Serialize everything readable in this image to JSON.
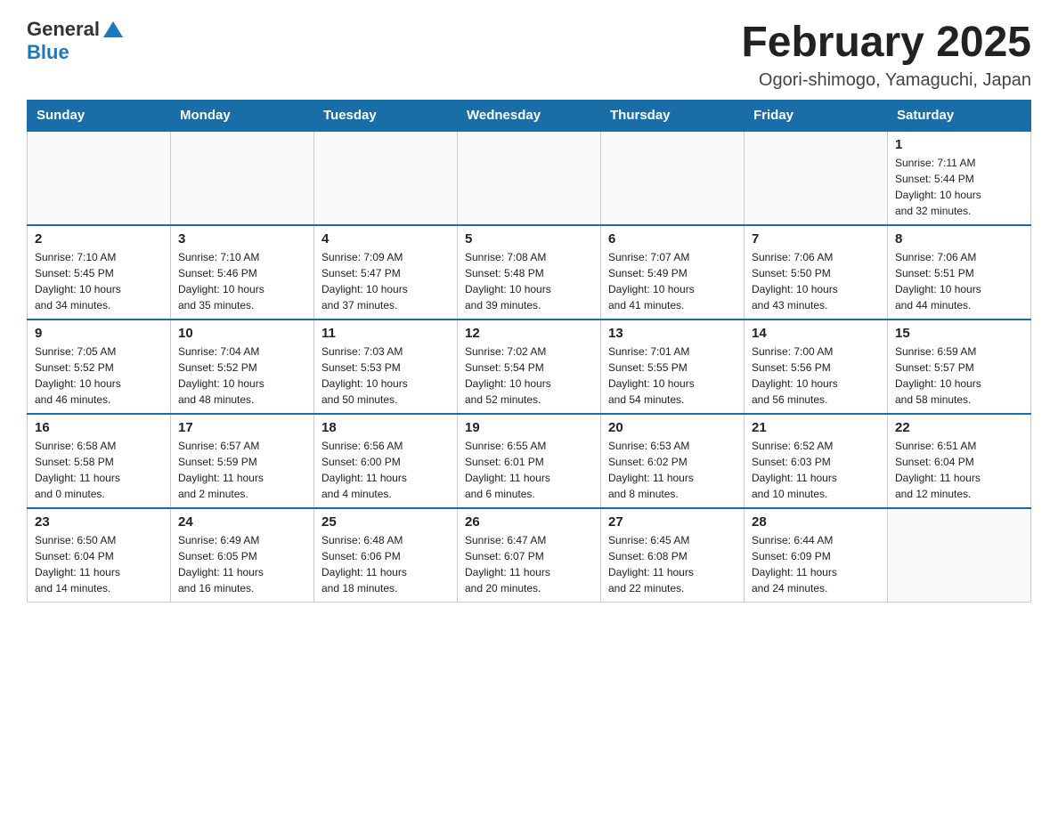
{
  "header": {
    "title": "February 2025",
    "subtitle": "Ogori-shimogo, Yamaguchi, Japan",
    "logo_general": "General",
    "logo_blue": "Blue"
  },
  "weekdays": [
    "Sunday",
    "Monday",
    "Tuesday",
    "Wednesday",
    "Thursday",
    "Friday",
    "Saturday"
  ],
  "weeks": [
    [
      {
        "day": "",
        "info": ""
      },
      {
        "day": "",
        "info": ""
      },
      {
        "day": "",
        "info": ""
      },
      {
        "day": "",
        "info": ""
      },
      {
        "day": "",
        "info": ""
      },
      {
        "day": "",
        "info": ""
      },
      {
        "day": "1",
        "info": "Sunrise: 7:11 AM\nSunset: 5:44 PM\nDaylight: 10 hours\nand 32 minutes."
      }
    ],
    [
      {
        "day": "2",
        "info": "Sunrise: 7:10 AM\nSunset: 5:45 PM\nDaylight: 10 hours\nand 34 minutes."
      },
      {
        "day": "3",
        "info": "Sunrise: 7:10 AM\nSunset: 5:46 PM\nDaylight: 10 hours\nand 35 minutes."
      },
      {
        "day": "4",
        "info": "Sunrise: 7:09 AM\nSunset: 5:47 PM\nDaylight: 10 hours\nand 37 minutes."
      },
      {
        "day": "5",
        "info": "Sunrise: 7:08 AM\nSunset: 5:48 PM\nDaylight: 10 hours\nand 39 minutes."
      },
      {
        "day": "6",
        "info": "Sunrise: 7:07 AM\nSunset: 5:49 PM\nDaylight: 10 hours\nand 41 minutes."
      },
      {
        "day": "7",
        "info": "Sunrise: 7:06 AM\nSunset: 5:50 PM\nDaylight: 10 hours\nand 43 minutes."
      },
      {
        "day": "8",
        "info": "Sunrise: 7:06 AM\nSunset: 5:51 PM\nDaylight: 10 hours\nand 44 minutes."
      }
    ],
    [
      {
        "day": "9",
        "info": "Sunrise: 7:05 AM\nSunset: 5:52 PM\nDaylight: 10 hours\nand 46 minutes."
      },
      {
        "day": "10",
        "info": "Sunrise: 7:04 AM\nSunset: 5:52 PM\nDaylight: 10 hours\nand 48 minutes."
      },
      {
        "day": "11",
        "info": "Sunrise: 7:03 AM\nSunset: 5:53 PM\nDaylight: 10 hours\nand 50 minutes."
      },
      {
        "day": "12",
        "info": "Sunrise: 7:02 AM\nSunset: 5:54 PM\nDaylight: 10 hours\nand 52 minutes."
      },
      {
        "day": "13",
        "info": "Sunrise: 7:01 AM\nSunset: 5:55 PM\nDaylight: 10 hours\nand 54 minutes."
      },
      {
        "day": "14",
        "info": "Sunrise: 7:00 AM\nSunset: 5:56 PM\nDaylight: 10 hours\nand 56 minutes."
      },
      {
        "day": "15",
        "info": "Sunrise: 6:59 AM\nSunset: 5:57 PM\nDaylight: 10 hours\nand 58 minutes."
      }
    ],
    [
      {
        "day": "16",
        "info": "Sunrise: 6:58 AM\nSunset: 5:58 PM\nDaylight: 11 hours\nand 0 minutes."
      },
      {
        "day": "17",
        "info": "Sunrise: 6:57 AM\nSunset: 5:59 PM\nDaylight: 11 hours\nand 2 minutes."
      },
      {
        "day": "18",
        "info": "Sunrise: 6:56 AM\nSunset: 6:00 PM\nDaylight: 11 hours\nand 4 minutes."
      },
      {
        "day": "19",
        "info": "Sunrise: 6:55 AM\nSunset: 6:01 PM\nDaylight: 11 hours\nand 6 minutes."
      },
      {
        "day": "20",
        "info": "Sunrise: 6:53 AM\nSunset: 6:02 PM\nDaylight: 11 hours\nand 8 minutes."
      },
      {
        "day": "21",
        "info": "Sunrise: 6:52 AM\nSunset: 6:03 PM\nDaylight: 11 hours\nand 10 minutes."
      },
      {
        "day": "22",
        "info": "Sunrise: 6:51 AM\nSunset: 6:04 PM\nDaylight: 11 hours\nand 12 minutes."
      }
    ],
    [
      {
        "day": "23",
        "info": "Sunrise: 6:50 AM\nSunset: 6:04 PM\nDaylight: 11 hours\nand 14 minutes."
      },
      {
        "day": "24",
        "info": "Sunrise: 6:49 AM\nSunset: 6:05 PM\nDaylight: 11 hours\nand 16 minutes."
      },
      {
        "day": "25",
        "info": "Sunrise: 6:48 AM\nSunset: 6:06 PM\nDaylight: 11 hours\nand 18 minutes."
      },
      {
        "day": "26",
        "info": "Sunrise: 6:47 AM\nSunset: 6:07 PM\nDaylight: 11 hours\nand 20 minutes."
      },
      {
        "day": "27",
        "info": "Sunrise: 6:45 AM\nSunset: 6:08 PM\nDaylight: 11 hours\nand 22 minutes."
      },
      {
        "day": "28",
        "info": "Sunrise: 6:44 AM\nSunset: 6:09 PM\nDaylight: 11 hours\nand 24 minutes."
      },
      {
        "day": "",
        "info": ""
      }
    ]
  ]
}
